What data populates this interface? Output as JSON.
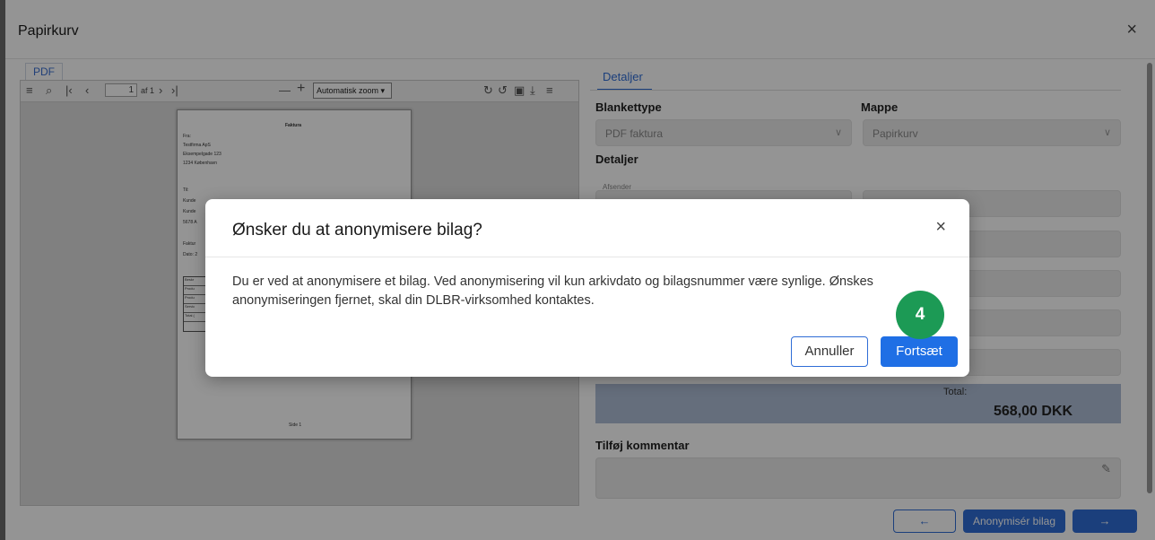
{
  "base": {
    "title": "Papirkurv",
    "close_icon": "×",
    "pdf": {
      "tab": "PDF",
      "page_value": "1",
      "page_of": "af 1",
      "zoom": "Automatisk zoom ▾",
      "page_content": {
        "heading": "Faktura",
        "from_label": "Fra:",
        "from_lines": [
          "Testfirma ApS",
          "Eksempelgade 123",
          "1234 København"
        ],
        "to_label": "Til:",
        "to_lines": [
          "Kunde",
          "Kunde",
          "5678 A"
        ],
        "invoice_label": "Faktur",
        "date_label": "Dato: 2",
        "table_rows": [
          "Beskr",
          "Produ",
          "Produ",
          "Servic",
          "Total ("
        ],
        "footer": "Side 1"
      }
    },
    "details": {
      "tab": "Detaljer",
      "blankettype_label": "Blankettype",
      "blankettype_value": "PDF faktura",
      "mappe_label": "Mappe",
      "mappe_value": "Papirkurv",
      "section_label": "Detaljer",
      "afsender_label": "Afsender",
      "total_label": "Total:",
      "total_value": "568,00 DKK",
      "comment_label": "Tilføj kommentar"
    },
    "buttons": {
      "prev": "←",
      "anonymize": "Anonymisér bilag",
      "next": "→"
    }
  },
  "modal": {
    "title": "Ønsker du at anonymisere bilag?",
    "close_icon": "×",
    "body": "Du er ved at anonymisere et bilag. Ved anonymisering vil kun arkivdato og bilagsnummer være synlige. Ønskes anonymiseringen fjernet, skal din DLBR-virksomhed kontaktes.",
    "cancel": "Annuller",
    "continue": "Fortsæt"
  },
  "step_badge": "4",
  "colors": {
    "primary": "#1f6fe5",
    "badge": "#1c9a55",
    "total_bg": "#aebed6"
  }
}
